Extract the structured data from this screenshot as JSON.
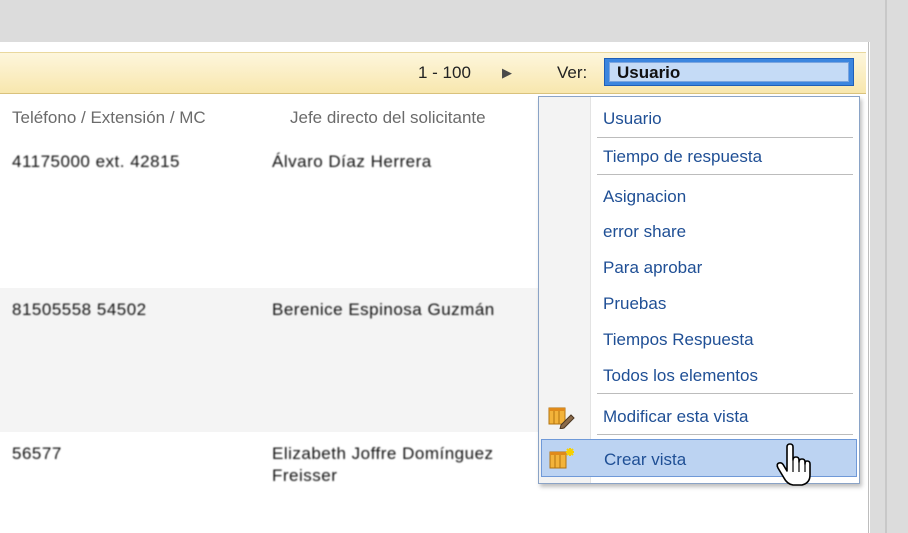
{
  "toolbar": {
    "paging_range": "1 - 100",
    "next_page_icon": "triangle-right-icon",
    "view_label": "Ver:",
    "view_selected": "Usuario"
  },
  "table": {
    "columns": [
      "Teléfono / Extensión / MC",
      "Jefe directo del solicitante"
    ],
    "rows": [
      {
        "phone": "41175000 ext. 42815",
        "manager": "Álvaro Díaz Herrera"
      },
      {
        "phone": "81505558 54502",
        "manager": "Berenice Espinosa Guzmán"
      },
      {
        "phone": "56577",
        "manager_line1": "Elizabeth Joffre Domínguez",
        "manager_line2": "Freisser"
      }
    ]
  },
  "menu": {
    "items": [
      {
        "label": "Usuario"
      },
      {
        "label": "Tiempo de respuesta"
      },
      {
        "label": "Asignacion"
      },
      {
        "label": "error share"
      },
      {
        "label": "Para aprobar"
      },
      {
        "label": "Pruebas"
      },
      {
        "label": "Tiempos Respuesta"
      },
      {
        "label": "Todos los elementos"
      },
      {
        "label": "Modificar esta vista",
        "icon": "edit-view-icon"
      },
      {
        "label": "Crear vista",
        "icon": "create-view-icon",
        "highlighted": true
      }
    ]
  },
  "colors": {
    "toolbar_bg": "#f8e7ae",
    "select_bg": "#3c86df",
    "menu_link": "#1f4f95",
    "highlight": "#bcd3f2"
  }
}
